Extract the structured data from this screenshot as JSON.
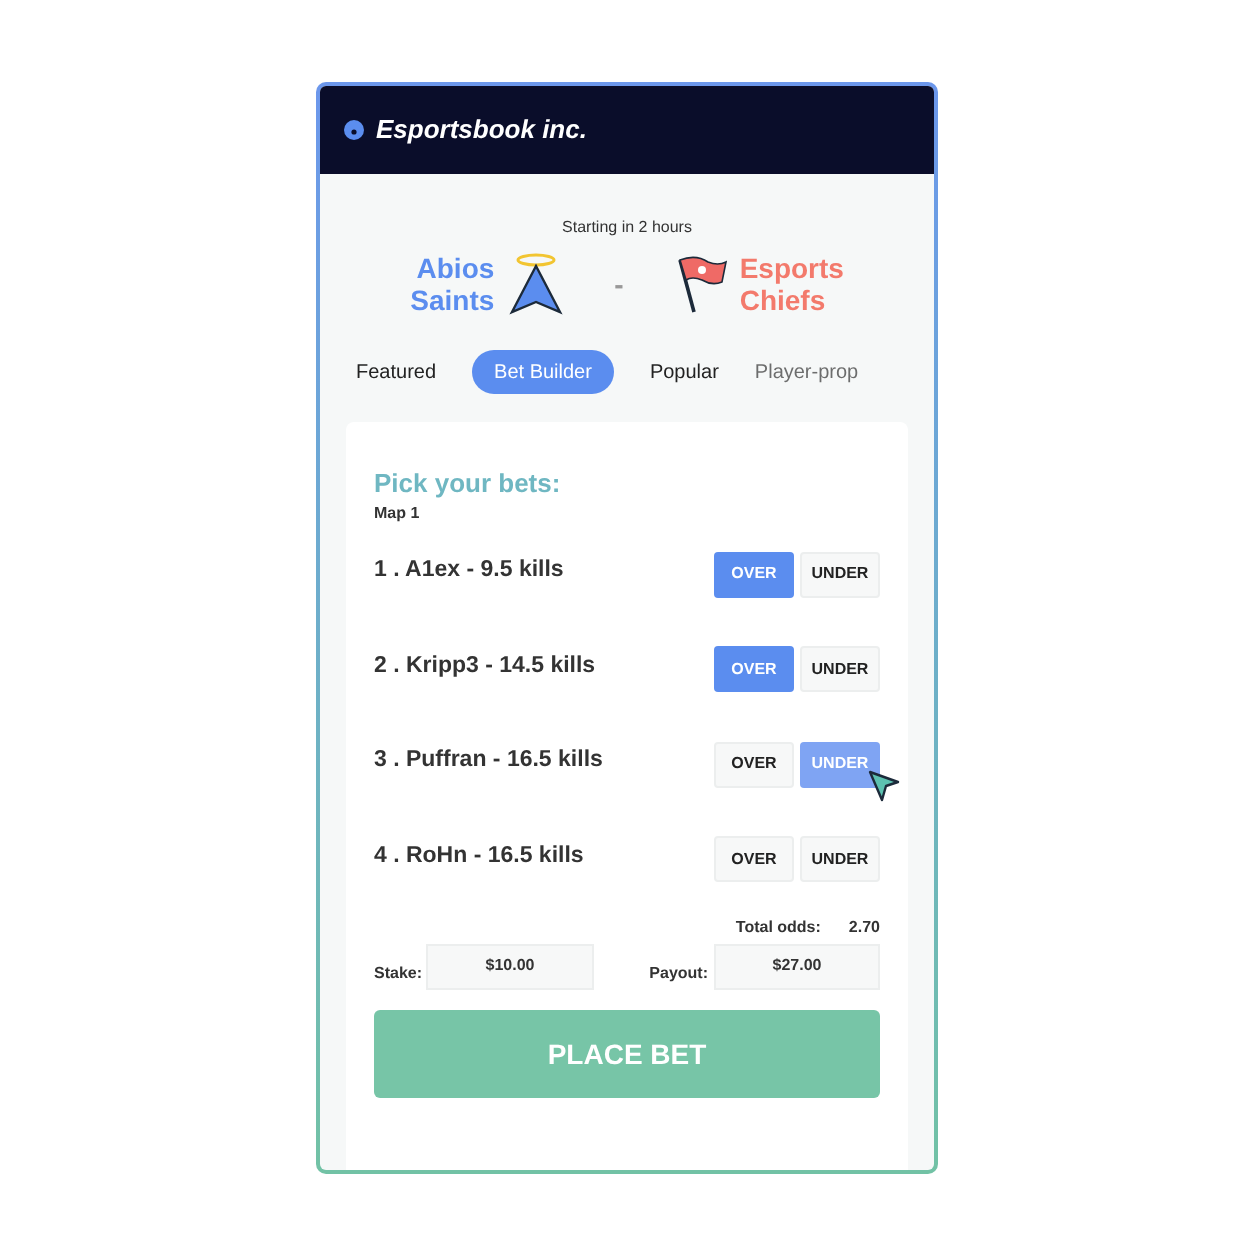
{
  "header": {
    "brand": "Esportsbook inc."
  },
  "match": {
    "status": "Starting in 2 hours",
    "home": {
      "name": "Abios Saints"
    },
    "separator": "-",
    "away": {
      "name": "Esports Chiefs"
    }
  },
  "tabs": [
    {
      "label": "Featured",
      "selected": false
    },
    {
      "label": "Bet Builder",
      "selected": true
    },
    {
      "label": "Popular",
      "selected": false
    },
    {
      "label": "Player-prop",
      "selected": false
    }
  ],
  "bets": {
    "title": "Pick your bets:",
    "subtitle": "Map 1",
    "rows": [
      {
        "label": "1 . A1ex - 9.5 kills",
        "options": [
          {
            "label": "OVER",
            "selected": true,
            "hovered": false
          },
          {
            "label": "UNDER",
            "selected": false,
            "hovered": false
          }
        ]
      },
      {
        "label": "2 . Kripp3 - 14.5 kills",
        "options": [
          {
            "label": "OVER",
            "selected": true,
            "hovered": false
          },
          {
            "label": "UNDER",
            "selected": false,
            "hovered": false
          }
        ]
      },
      {
        "label": "3 . Puffran - 16.5 kills",
        "options": [
          {
            "label": "OVER",
            "selected": false,
            "hovered": false
          },
          {
            "label": "UNDER",
            "selected": false,
            "hovered": true
          }
        ]
      },
      {
        "label": "4 . RoHn - 16.5 kills",
        "options": [
          {
            "label": "OVER",
            "selected": false,
            "hovered": false
          },
          {
            "label": "UNDER",
            "selected": false,
            "hovered": false
          }
        ]
      }
    ],
    "total_odds_label": "Total odds:",
    "total_odds": "2.70",
    "stake_label": "Stake:",
    "stake": "$10.00",
    "payout_label": "Payout:",
    "payout": "$27.00",
    "place_bet": "PLACE BET"
  }
}
